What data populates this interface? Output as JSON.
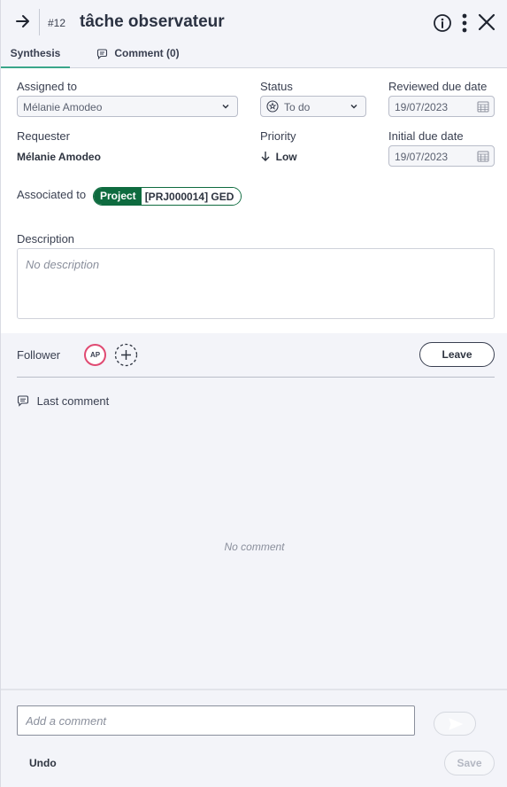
{
  "header": {
    "task_number": "#12",
    "title": "tâche observateur"
  },
  "tabs": [
    {
      "label": "Synthesis",
      "active": true
    },
    {
      "label": "Comment (0)",
      "active": false
    }
  ],
  "fields": {
    "assigned_to": {
      "label": "Assigned to",
      "value": "Mélanie Amodeo"
    },
    "status": {
      "label": "Status",
      "value": "To do"
    },
    "reviewed_due_date": {
      "label": "Reviewed due date",
      "value": "19/07/2023"
    },
    "requester": {
      "label": "Requester",
      "value": "Mélanie Amodeo"
    },
    "priority": {
      "label": "Priority",
      "value": "Low"
    },
    "initial_due_date": {
      "label": "Initial due date",
      "value": "19/07/2023"
    }
  },
  "associated": {
    "label": "Associated to",
    "type": "Project",
    "text": "[PRJ000014] GED"
  },
  "description": {
    "label": "Description",
    "placeholder": "No description"
  },
  "follower": {
    "label": "Follower",
    "avatar_initials": "AP",
    "leave_label": "Leave"
  },
  "last_comment": {
    "label": "Last comment",
    "empty_text": "No comment"
  },
  "footer": {
    "comment_placeholder": "Add a comment",
    "undo_label": "Undo",
    "save_label": "Save"
  },
  "colors": {
    "accent": "#3aa68a",
    "project_chip": "#0e6b3f",
    "avatar_ring": "#e04a72"
  }
}
